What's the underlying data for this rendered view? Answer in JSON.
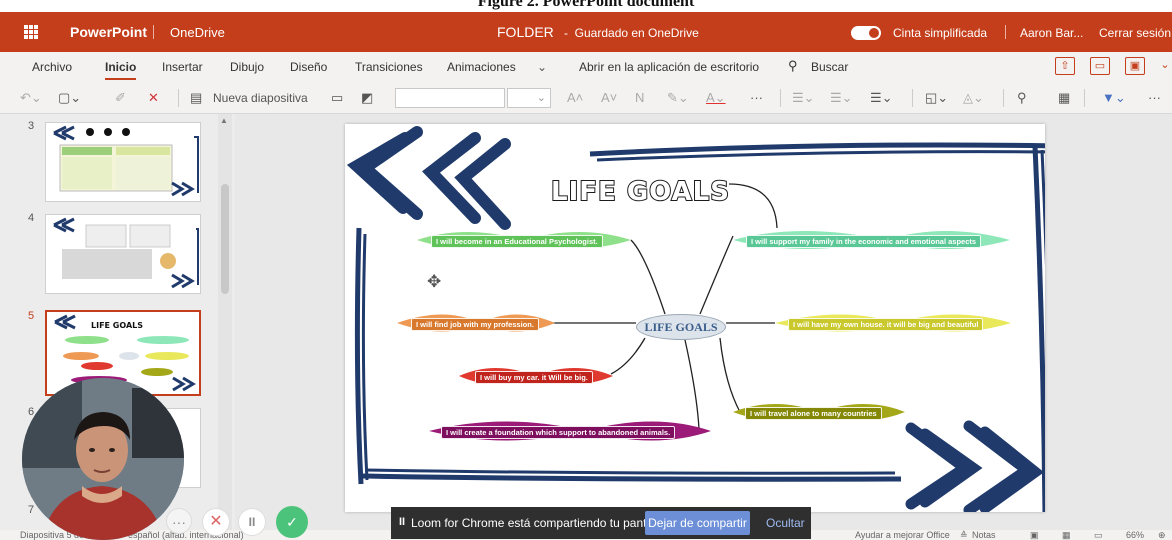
{
  "caption": "Figure 2. PowerPoint document",
  "titlebar": {
    "app_name": "PowerPoint",
    "location": "OneDrive",
    "document_name": "FOLDER",
    "save_status": "Guardado en OneDrive",
    "simplified_ribbon_label": "Cinta simplificada",
    "user_name": "Aaron Bar...",
    "sign_out": "Cerrar sesión"
  },
  "tabs": [
    {
      "label": "Archivo"
    },
    {
      "label": "Inicio",
      "active": true
    },
    {
      "label": "Insertar"
    },
    {
      "label": "Dibujo"
    },
    {
      "label": "Diseño"
    },
    {
      "label": "Transiciones"
    },
    {
      "label": "Animaciones"
    },
    {
      "label": "Abrir en la aplicación de escritorio"
    },
    {
      "label": "Buscar"
    }
  ],
  "ribbon": {
    "new_slide_label": "Nueva diapositiva",
    "font_name": "",
    "font_size": ""
  },
  "thumbnails": [
    {
      "number": "3"
    },
    {
      "number": "4"
    },
    {
      "number": "5",
      "selected": true
    },
    {
      "number": "6"
    },
    {
      "number": "7"
    }
  ],
  "slide": {
    "title": "LIFE GOALS",
    "center": "LIFE GOALS",
    "branches": [
      {
        "text": "I will become in an Educational Psychologist.",
        "color": "#8fe08a"
      },
      {
        "text": "I will support my family in the economic and emotional aspects",
        "color": "#8ee7b8"
      },
      {
        "text": "I will find job with my profession.",
        "color": "#ee9a55"
      },
      {
        "text": "I will have my own house. it will be big and beautiful",
        "color": "#e8e85a"
      },
      {
        "text": "I will buy my car. it Will be big.",
        "color": "#e0392f"
      },
      {
        "text": "I will travel alone to many countries",
        "color": "#a4a818"
      },
      {
        "text": "I will create a foundation which support to abandoned animals.",
        "color": "#9c1a78"
      }
    ]
  },
  "loom": {
    "message": "Loom for Chrome está compartiendo tu pantalla.",
    "stop_label": "Dejar de compartir",
    "hide_label": "Ocultar"
  },
  "status": {
    "slide_info": "Diapositiva 5 de 11",
    "language": "español (alfab. internacional)",
    "help": "Ayudar a mejorar Office",
    "notes": "Notas",
    "zoom": "66%"
  }
}
